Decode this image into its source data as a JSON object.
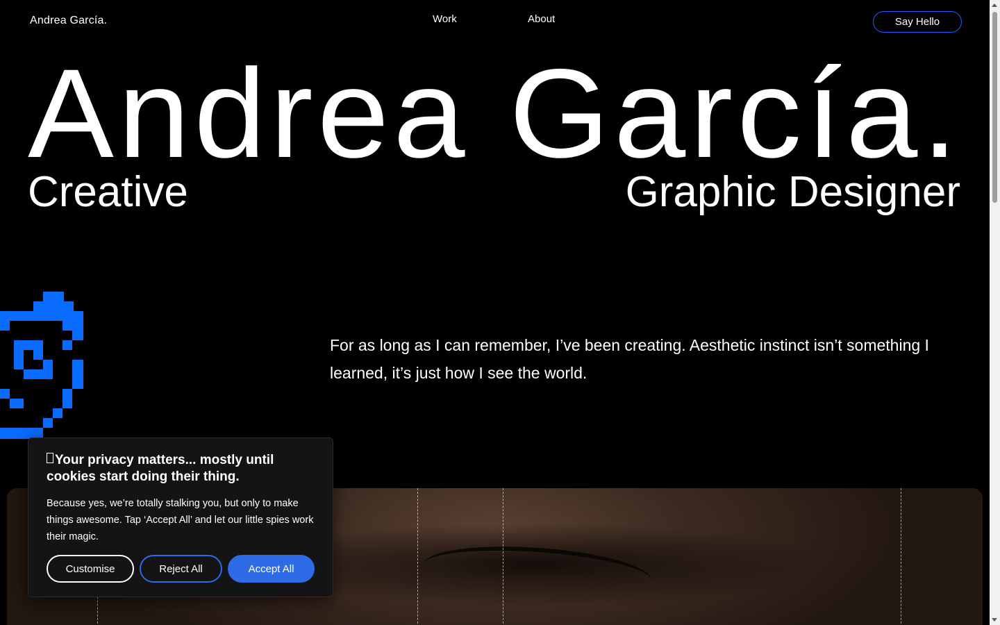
{
  "header": {
    "brand": "Andrea García.",
    "nav": [
      {
        "label": "Work"
      },
      {
        "label": "About"
      }
    ],
    "cta_label": "Say Hello"
  },
  "hero": {
    "name": "Andrea García.",
    "left_tagline": "Creative",
    "right_tagline": "Graphic Designer"
  },
  "intro": {
    "text": "For as long as I can remember, I’ve been creating. Aesthetic instinct isn’t something I learned, it’s just how I see the world."
  },
  "cookie_banner": {
    "title": "Your privacy matters... mostly until cookies start doing their thing.",
    "body": "Because yes, we’re totally stalking you, but only to make things awesome. Tap ‘Accept All’ and let our little spies work their magic.",
    "buttons": {
      "customise": "Customise",
      "reject": "Reject All",
      "accept": "Accept All"
    }
  },
  "colors": {
    "background": "#000000",
    "accent_blue": "#1f5cff",
    "button_blue": "#2e6be6",
    "pixel_icon_blue": "#0a6cff"
  },
  "icons": {
    "pixel_graphic": "pixel-face-icon",
    "missing_glyph": "missing-glyph-icon"
  }
}
